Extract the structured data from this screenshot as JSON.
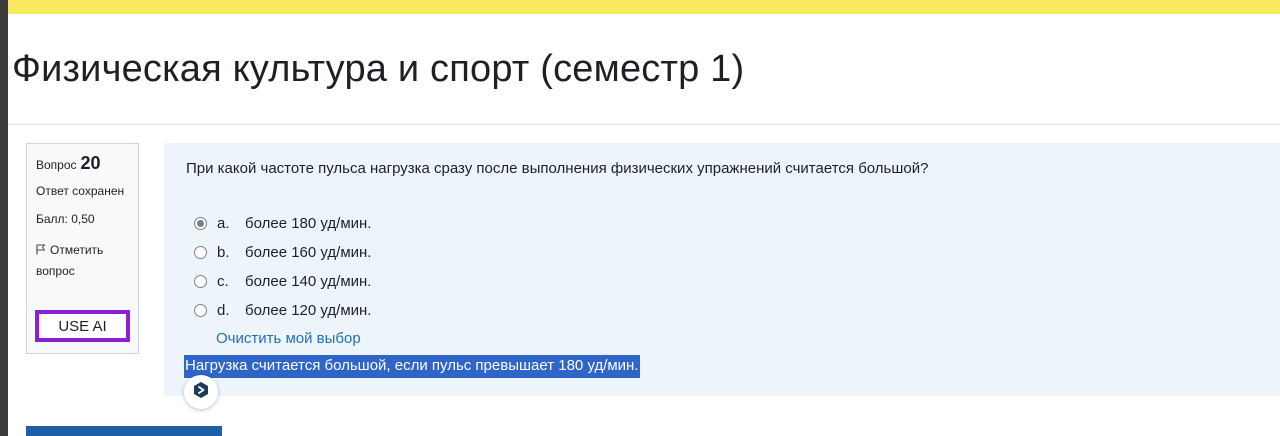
{
  "page": {
    "title": "Физическая культура и спорт (семестр 1)"
  },
  "question_info": {
    "label": "Вопрос",
    "number": "20",
    "state": "Ответ сохранен",
    "grade": "Балл: 0,50",
    "flag_label": "Отметить вопрос",
    "use_ai_label": "USE AI"
  },
  "question": {
    "text": "При какой частоте пульса нагрузка сразу после выполнения физических упражнений считается большой?",
    "answers": [
      {
        "letter": "a.",
        "text": "более 180 уд/мин.",
        "selected": true
      },
      {
        "letter": "b.",
        "text": "более 160 уд/мин.",
        "selected": false
      },
      {
        "letter": "c.",
        "text": "более 140 уд/мин.",
        "selected": false
      },
      {
        "letter": "d.",
        "text": "более 120 уд/мин.",
        "selected": false
      }
    ],
    "clear_label": "Очистить мой выбор",
    "ai_answer": "Нагрузка считается большой, если пульс превышает 180 уд/мин."
  },
  "colors": {
    "top_bar": "#f9e960",
    "use_ai_border": "#8d1fd8",
    "link": "#1f6fb5",
    "highlight": "#2f65c7",
    "content_bg": "#eef5fa"
  },
  "icons": {
    "flag": "flag-icon",
    "ai_badge": "ai-extension-icon"
  }
}
